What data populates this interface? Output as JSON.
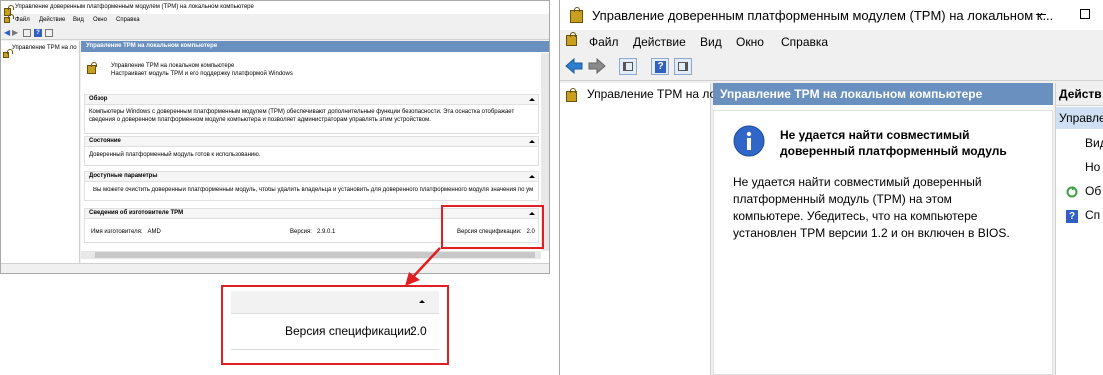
{
  "left_window": {
    "title": "Управление доверенным платформенным модулем (TPM) на локальном компьютере",
    "menu": [
      "Файл",
      "Действие",
      "Вид",
      "Окно",
      "Справка"
    ],
    "tree_item": "Управление TPM на ло",
    "pane_header": "Управление TPM на локальном компьютере",
    "intro_title": "Управление TPM на локальном компьютере",
    "intro_text": "Настраивает модуль TPM и его поддержку платформой Windows",
    "sections": [
      {
        "title": "Обзор",
        "text": "Компьютеры Windows с доверенным платформенным модулем (TPM) обеспечивают дополнительные функции безопасности. Эта оснастка отображает сведения о доверенном платформенном модуле компьютера и позволяет администраторам управлять этим устройством."
      },
      {
        "title": "Состояние",
        "text": "Доверенный платформенный модуль готов к использованию."
      },
      {
        "title": "Доступные параметры",
        "text": "Вы можете очистить доверенный платформенный модуль, чтобы удалить владельца и установить для доверенного платформенного модуля значения по умолчанию."
      },
      {
        "title": "Сведения об изготовителе TPM",
        "manufacturer": "Имя изготовителя:   AMD",
        "version": "Версия:   2.9.0.1",
        "spec": "Версия спецификации:   2.0"
      }
    ]
  },
  "zoom": {
    "spec_label": "Версия спецификации:",
    "spec_value": "2.0"
  },
  "right_window": {
    "title": "Управление доверенным платформенным модулем (TPM) на локальном к...",
    "menu": [
      "Файл",
      "Действие",
      "Вид",
      "Окно",
      "Справка"
    ],
    "tree_item": "Управление TPM на ло",
    "pane_header": "Управление TPM на локальном компьютере",
    "error_title": "Не удается найти совместимый доверенный платформенный модуль",
    "error_text": "Не удается найти совместимый доверенный платформенный модуль (TPM) на этом компьютере. Убедитесь, что на компьютере установлен TPM версии 1.2 и он включен в BIOS.",
    "actions_header": "Действ",
    "actions": [
      "Управле",
      "Вид",
      "Но",
      "Об",
      "Сп"
    ]
  },
  "colors": {
    "highlight_red": "#e02020",
    "header_blue": "#6a90c0",
    "accent_blue": "#3060c0"
  }
}
